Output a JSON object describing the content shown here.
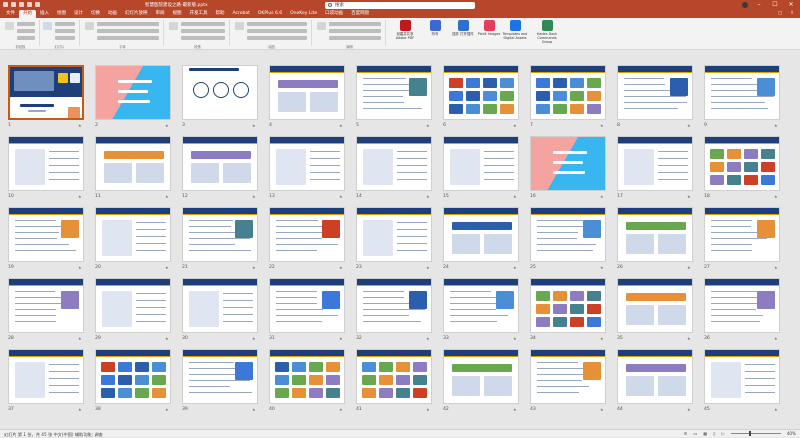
{
  "window": {
    "title": "智慧医院建设之路-最新版.pptx"
  },
  "search": {
    "placeholder": "搜索"
  },
  "tabs": [
    "文件",
    "开始",
    "插入",
    "绘图",
    "设计",
    "切换",
    "动画",
    "幻灯片放映",
    "审阅",
    "视图",
    "开发工具",
    "帮助",
    "Acrobat",
    "OKPlus 6.6",
    "OneKey Lite",
    "口袋动画",
    "百度网盘"
  ],
  "active_tab": "开始",
  "ribbon": {
    "groups": [
      "剪贴板",
      "幻灯片",
      "字体",
      "段落",
      "绘图",
      "编辑"
    ],
    "addins": [
      {
        "label": "创建并共享 Adobe PDF",
        "color": "#c4171c"
      },
      {
        "label": "听写",
        "color": "#3a6ad1"
      },
      {
        "label": "插件 打开插件",
        "color": "#2f6fd1"
      },
      {
        "label": "Pickit Images",
        "color": "#e63d5b"
      },
      {
        "label": "Templates and Digital Assets",
        "color": "#1a73e8"
      },
      {
        "label": "Hades Dock Commands Group",
        "color": "#2e8b57"
      }
    ]
  },
  "slides": {
    "rows": [
      [
        "1",
        "2",
        "3",
        "4",
        "5",
        "6",
        "7",
        "8",
        "9"
      ],
      [
        "10",
        "11",
        "12",
        "13",
        "14",
        "15",
        "16",
        "17",
        "18"
      ],
      [
        "19",
        "20",
        "21",
        "22",
        "23",
        "24",
        "25",
        "26",
        "27"
      ],
      [
        "28",
        "29",
        "30",
        "31",
        "32",
        "33",
        "34",
        "35",
        "36"
      ],
      [
        "37",
        "38",
        "39",
        "40",
        "41",
        "42",
        "43",
        "44",
        "45"
      ]
    ],
    "selected": "1"
  },
  "status": {
    "left": "幻灯片 第 1 张，共 45 张  中文(中国)  辅助功能: 调查",
    "zoom": "40%"
  },
  "colors": {
    "accent": "#b7472a",
    "navy": "#1f3f7a",
    "gold": "#d9a400",
    "pink": "#f4a3a0",
    "sky": "#37b6f0"
  }
}
